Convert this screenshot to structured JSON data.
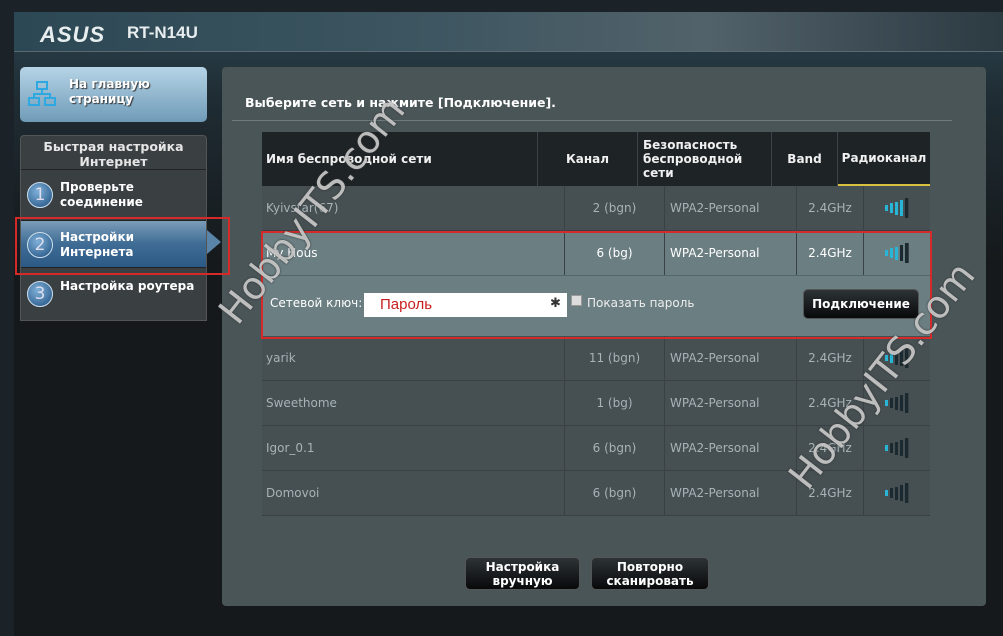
{
  "header": {
    "brand": "ASUS",
    "model": "RT-N14U"
  },
  "sidebar": {
    "home_label": "На главную страницу",
    "quick_setup_title": "Быстрая настройка Интернет",
    "steps": [
      {
        "num": "1",
        "label": "Проверьте соединение"
      },
      {
        "num": "2",
        "label": "Настройки Интернета"
      },
      {
        "num": "3",
        "label": "Настройка роутера"
      }
    ],
    "active_step": 2
  },
  "main": {
    "title": "Выберите сеть и нажмите [Подключение].",
    "columns": [
      "Имя беспроводной сети",
      "Канал",
      "Безопасность беспроводной сети",
      "Band",
      "Радиоканал"
    ],
    "networks": [
      {
        "ssid": "Kyivstar(67)",
        "channel": "2 (bgn)",
        "security": "WPA2-Personal",
        "band": "2.4GHz",
        "signal": 4
      },
      {
        "ssid": "My Hous",
        "channel": "6 (bg)",
        "security": "WPA2-Personal",
        "band": "2.4GHz",
        "signal": 3
      },
      {
        "ssid": "yarik",
        "channel": "11 (bgn)",
        "security": "WPA2-Personal",
        "band": "2.4GHz",
        "signal": 2
      },
      {
        "ssid": "Sweethome",
        "channel": "1 (bg)",
        "security": "WPA2-Personal",
        "band": "2.4GHz",
        "signal": 1
      },
      {
        "ssid": "Igor_0.1",
        "channel": "6 (bgn)",
        "security": "WPA2-Personal",
        "band": "2.4GHz",
        "signal": 1
      },
      {
        "ssid": "Domovoi",
        "channel": "6 (bgn)",
        "security": "WPA2-Personal",
        "band": "2.4GHz",
        "signal": 1
      }
    ],
    "key_label": "Сетевой ключ:",
    "key_value": "Пароль",
    "show_password_label": "Показать пароль",
    "connect_label": "Подключение",
    "manual_label": "Настройка вручную",
    "rescan_label": "Повторно сканировать"
  },
  "watermark": "HobbyITS.com",
  "colors": {
    "accent": "#28b5d6",
    "highlight": "#d42a2a"
  }
}
